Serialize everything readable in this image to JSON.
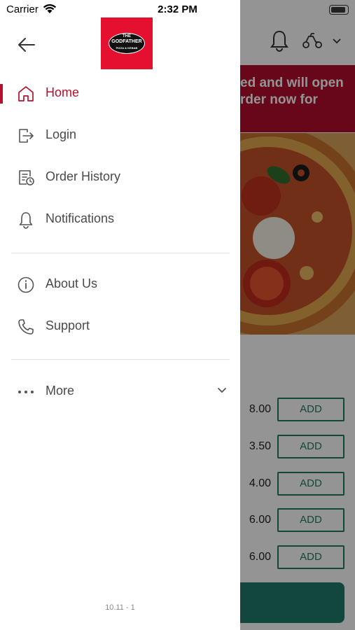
{
  "status_bar": {
    "carrier": "Carrier",
    "time": "2:32 PM"
  },
  "background": {
    "banner_line1": "ed and will open",
    "banner_line2": "rder now for",
    "prices": [
      "8.00",
      "3.50",
      "4.00",
      "6.00",
      "6.00"
    ],
    "add_label": "ADD"
  },
  "drawer": {
    "logo": {
      "line1": "THE",
      "line2": "GODFATHER",
      "line3": "PIZZA & KEBAB"
    },
    "menu": [
      {
        "label": "Home",
        "icon": "home-icon",
        "active": true
      },
      {
        "label": "Login",
        "icon": "login-icon"
      },
      {
        "label": "Order History",
        "icon": "order-history-icon"
      },
      {
        "label": "Notifications",
        "icon": "bell-icon"
      },
      {
        "label": "About Us",
        "icon": "info-icon"
      },
      {
        "label": "Support",
        "icon": "phone-icon"
      },
      {
        "label": "More",
        "icon": "ellipsis-icon"
      }
    ],
    "version": "10.11 - 1"
  },
  "colors": {
    "accent": "#b5102f",
    "logo_red": "#e5102f",
    "teal": "#1f7a6a"
  }
}
